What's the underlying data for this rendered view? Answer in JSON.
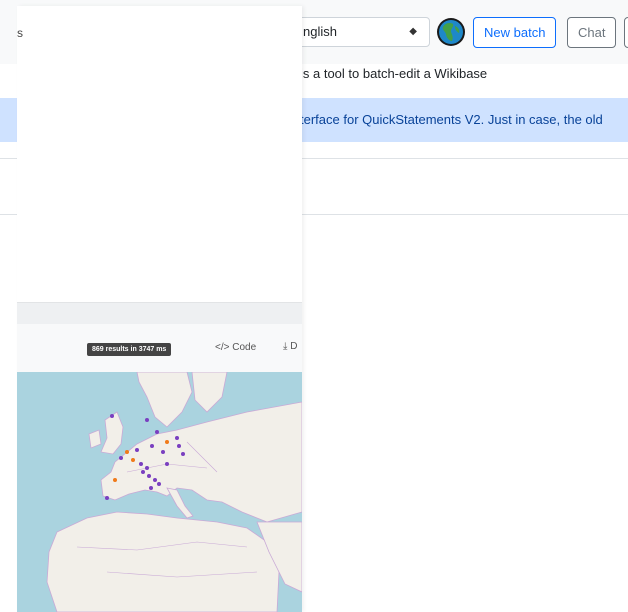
{
  "header": {
    "language_select": "nglish",
    "new_batch_label": "New batch",
    "chat_label": "Chat"
  },
  "intro": {
    "text": "is a tool to batch-edit a Wikibase"
  },
  "alert": {
    "text": "terface for QuickStatements V2. Just in case, the old"
  },
  "overlay": {
    "side_letter": "s",
    "results_badge": "869 results in 3747 ms",
    "code_label": "</> Code",
    "download_label": "⤓ D"
  },
  "colors": {
    "primary": "#0d6efd",
    "secondary": "#6c757d",
    "alert_bg": "#cfe2ff",
    "marker_purple": "#7a3fc0",
    "marker_orange": "#f07a1a"
  },
  "icons": [
    "globe-icon",
    "caret-icon",
    "code-icon",
    "download-icon"
  ]
}
